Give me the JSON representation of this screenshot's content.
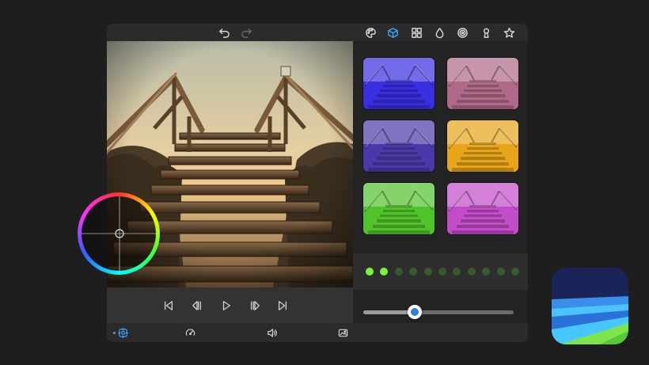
{
  "toolbar": {
    "undo_icon": "undo-icon",
    "redo_icon": "redo-icon",
    "tools": [
      "palette-icon",
      "cube-icon",
      "grid-icon",
      "drop-icon",
      "spiral-icon",
      "keyhole-icon",
      "star-icon"
    ],
    "active_tool": "cube-icon"
  },
  "transport": {
    "buttons": [
      "skip-start-icon",
      "step-back-icon",
      "play-icon",
      "step-forward-icon",
      "skip-end-icon"
    ]
  },
  "bottom_bar": {
    "buttons": [
      "adjust-icon",
      "speed-icon",
      "volume-icon",
      "filter-image-icon"
    ],
    "active": "adjust-icon"
  },
  "filters": [
    {
      "name": "filter-indigo",
      "tint": "#3a2ee0"
    },
    {
      "name": "filter-rose",
      "tint": "#b06a8a"
    },
    {
      "name": "filter-violet-duo",
      "tint": "#4a3aa8"
    },
    {
      "name": "filter-amber",
      "tint": "#e8a51a"
    },
    {
      "name": "filter-green",
      "tint": "#52c22a"
    },
    {
      "name": "filter-magenta",
      "tint": "#c44cc8"
    }
  ],
  "intensity_dots": {
    "count": 11,
    "active": 2
  },
  "intensity_slider": {
    "value": 0.34
  },
  "colors": {
    "accent": "#3fa2ff",
    "dot_on": "#7bf53c",
    "dot_off": "#3a5a2c",
    "app_bg": "#2b2b2b",
    "page_bg": "#1e1e1e"
  },
  "overlay": {
    "color_wheel": "color-wheel"
  },
  "app_logo": "app-logo-icon"
}
